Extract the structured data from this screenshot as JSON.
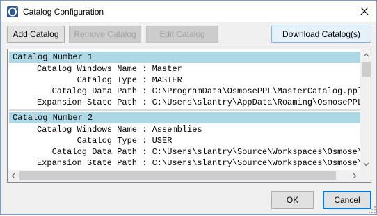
{
  "window": {
    "title": "Catalog Configuration",
    "icon": "app-logo-icon",
    "close_icon": "close-icon"
  },
  "toolbar": {
    "add_label": "Add Catalog",
    "remove_label": "Remove Catalog",
    "edit_label": "Edit Catalog",
    "download_label": "Download Catalog(s)"
  },
  "catalogs": [
    {
      "header": "Catalog Number 1",
      "fields": [
        {
          "key": "Catalog Windows Name",
          "value": "Master"
        },
        {
          "key": "Catalog Type",
          "value": "MASTER"
        },
        {
          "key": "Catalog Data Path",
          "value": "C:\\ProgramData\\OsmosePPL\\MasterCatalog.pplc"
        },
        {
          "key": "Expansion State Path",
          "value": "C:\\Users\\slantry\\AppData\\Roaming\\OsmosePPL\\"
        }
      ]
    },
    {
      "header": "Catalog Number 2",
      "fields": [
        {
          "key": "Catalog Windows Name",
          "value": "Assemblies"
        },
        {
          "key": "Catalog Type",
          "value": "USER"
        },
        {
          "key": "Catalog Data Path",
          "value": "C:\\Users\\slantry\\Source\\Workspaces\\Osmose\\D"
        },
        {
          "key": "Expansion State Path",
          "value": "C:\\Users\\slantry\\Source\\Workspaces\\Osmose\\D"
        }
      ]
    }
  ],
  "footer": {
    "ok_label": "OK",
    "cancel_label": "Cancel"
  },
  "colors": {
    "header_bg": "#add8e6",
    "accent": "#0078d7"
  }
}
